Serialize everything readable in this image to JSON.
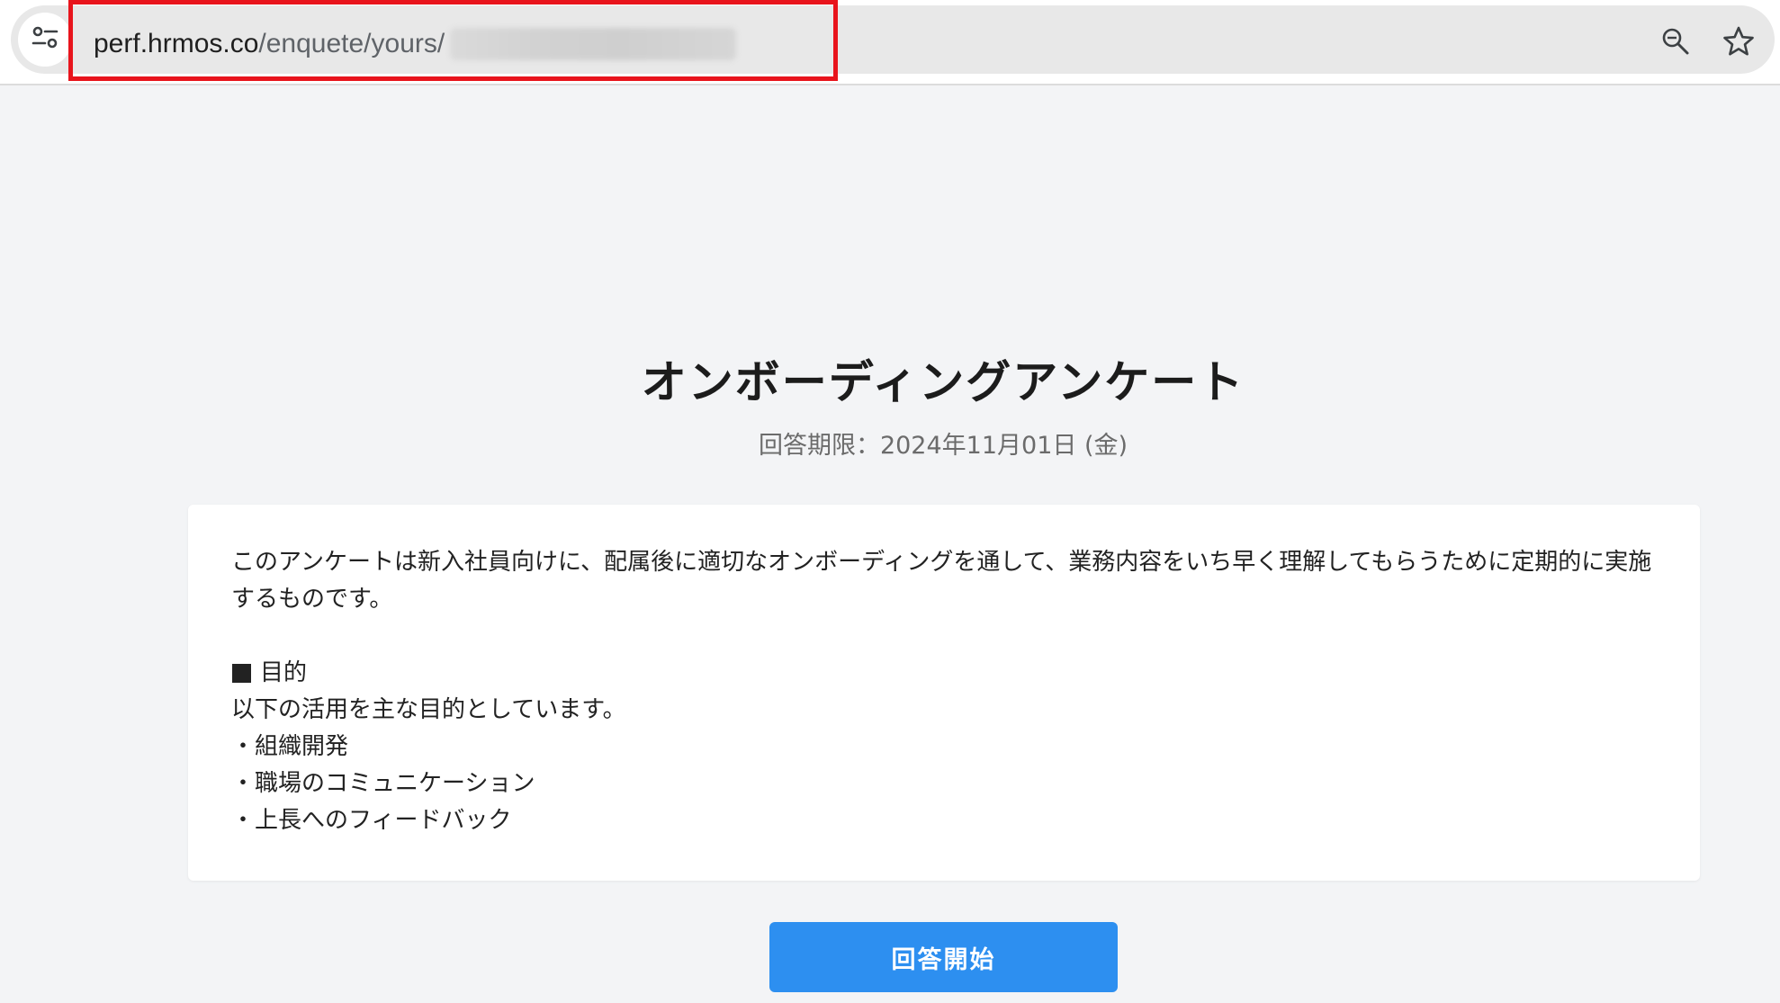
{
  "browser": {
    "url_host": "perf.hrmos.co",
    "url_path": "/enquete/yours/",
    "site_info_icon": "tune-icon",
    "zoom_icon": "zoom-icon",
    "bookmark_icon": "star-icon",
    "highlight_color": "#e8141c"
  },
  "survey": {
    "title": "オンボーディングアンケート",
    "deadline": "回答期限：2024年11月01日 (金)",
    "intro": "このアンケートは新入社員向けに、配属後に適切なオンボーディングを通して、業務内容をいち早く理解してもらうために定期的に実施するものです。",
    "purpose_heading": "目的",
    "purpose_text": "以下の活用を主な目的としています。",
    "purposes": [
      "・組織開発",
      "・職場のコミュニケーション",
      "・上長へのフィードバック"
    ],
    "start_button": "回答開始"
  },
  "colors": {
    "background": "#f3f4f6",
    "button": "#2d8ff0",
    "title": "#1c1c1c"
  }
}
